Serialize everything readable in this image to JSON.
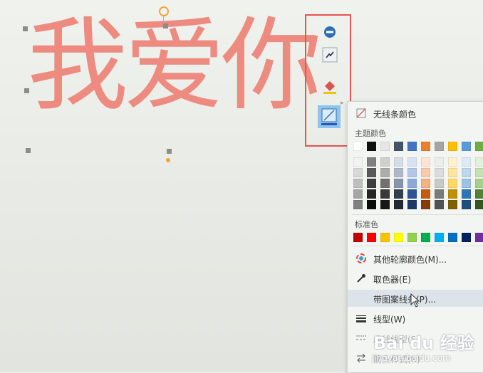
{
  "canvas": {
    "text": "我爱你",
    "text_color": "#ee8b80"
  },
  "mini_toolbar": {
    "buttons": [
      {
        "icon": "style-minus-icon"
      },
      {
        "icon": "shape-fill-icon"
      },
      {
        "icon": "paint-bucket-icon"
      },
      {
        "icon": "outline-color-icon"
      }
    ],
    "highlight_color": "#e8524f"
  },
  "outline_menu": {
    "no_line_label": "无线条颜色",
    "theme_colors_label": "主题颜色",
    "standard_colors_label": "标准色",
    "more_colors_label": "其他轮廓颜色(M)...",
    "eyedropper_label": "取色器(E)",
    "gradient_line_label": "带图案线条(P)...",
    "line_style_label": "线型(W)",
    "dash_label": "虚线线型(S)",
    "arrow_label": "箭头样式(R)",
    "theme_top_row": [
      "#ffffff",
      "#111111",
      "#e7e6e6",
      "#44546a",
      "#4472c4",
      "#ed7d31",
      "#a5a5a5",
      "#ffc000",
      "#5b9bd5",
      "#70ad47"
    ],
    "theme_shades": [
      [
        "#f2f2f2",
        "#7f7f7f",
        "#d0cece",
        "#d6dce4",
        "#d9e2f3",
        "#fbe5d5",
        "#ededed",
        "#fff2cc",
        "#deebf6",
        "#e2efd9"
      ],
      [
        "#d8d8d8",
        "#595959",
        "#aeabab",
        "#adb9ca",
        "#b4c6e7",
        "#f7cbac",
        "#dbdbdb",
        "#fee599",
        "#bdd7ee",
        "#c5e0b3"
      ],
      [
        "#bfbfbf",
        "#3f3f3f",
        "#757070",
        "#8496b0",
        "#8eaadb",
        "#f4b183",
        "#c9c9c9",
        "#ffd965",
        "#9cc3e5",
        "#a8d08d"
      ],
      [
        "#a5a5a5",
        "#262626",
        "#3a3838",
        "#323f4f",
        "#2f5496",
        "#c55a11",
        "#7b7b7b",
        "#bf8f00",
        "#2e75b5",
        "#538135"
      ],
      [
        "#7f7f7f",
        "#0c0c0c",
        "#171616",
        "#222a35",
        "#1f3864",
        "#833c0b",
        "#525252",
        "#7f6000",
        "#1e4e79",
        "#375623"
      ]
    ],
    "standard_colors": [
      "#c00000",
      "#ff0000",
      "#ffc000",
      "#ffff00",
      "#92d050",
      "#00b050",
      "#00b0f0",
      "#0070c0",
      "#002060",
      "#7030a0"
    ]
  },
  "watermark": {
    "brand": "Bai du 经验",
    "url": "jingyan.baidu.com"
  }
}
